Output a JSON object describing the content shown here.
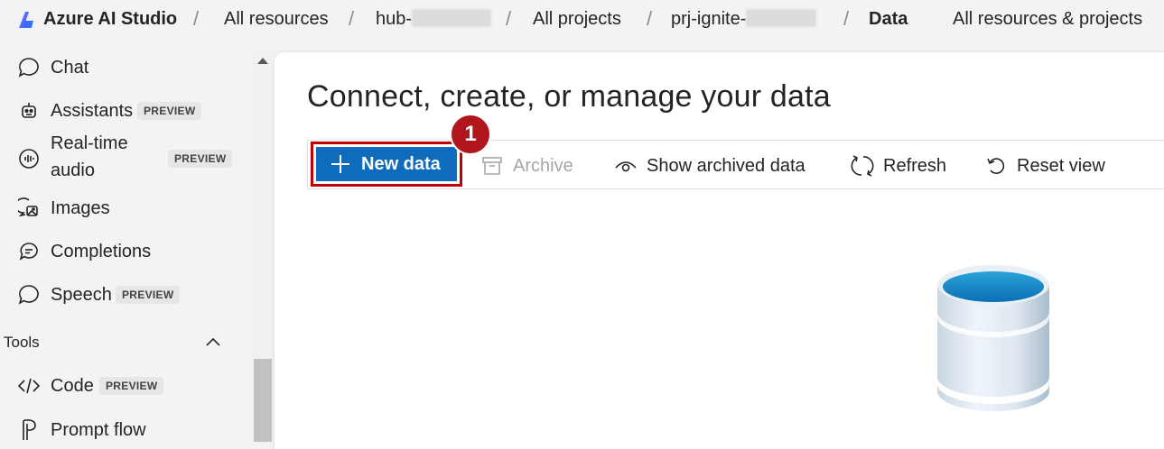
{
  "topbar": {
    "brand": "Azure AI Studio",
    "crumbs": [
      "All resources",
      "hub-",
      "All projects",
      "prj-ignite-",
      "Data"
    ],
    "right_link": "All resources & projects"
  },
  "sidebar": {
    "items": [
      {
        "label": "Chat",
        "icon": "chat-icon"
      },
      {
        "label": "Assistants",
        "badge": "PREVIEW",
        "icon": "bot-icon"
      },
      {
        "label_line1": "Real-time",
        "label_line2": "audio",
        "badge": "PREVIEW",
        "icon": "audio-icon"
      },
      {
        "label": "Images",
        "icon": "images-icon"
      },
      {
        "label": "Completions",
        "icon": "completions-icon"
      },
      {
        "label": "Speech",
        "badge": "PREVIEW",
        "icon": "speech-icon"
      }
    ],
    "section_tools": "Tools",
    "tools": [
      {
        "label": "Code",
        "badge": "PREVIEW",
        "icon": "code-icon"
      },
      {
        "label": "Prompt flow",
        "icon": "prompt-flow-icon"
      }
    ]
  },
  "main": {
    "title": "Connect, create, or manage your data",
    "step_number": "1",
    "toolbar": {
      "new_data": "New data",
      "archive": "Archive",
      "show_archived": "Show archived data",
      "refresh": "Refresh",
      "reset_view": "Reset view"
    }
  },
  "colors": {
    "primary": "#0f6cbd",
    "highlight": "#c00000",
    "step_badge": "#b0161b",
    "disabled_text": "#a6a6a6"
  }
}
